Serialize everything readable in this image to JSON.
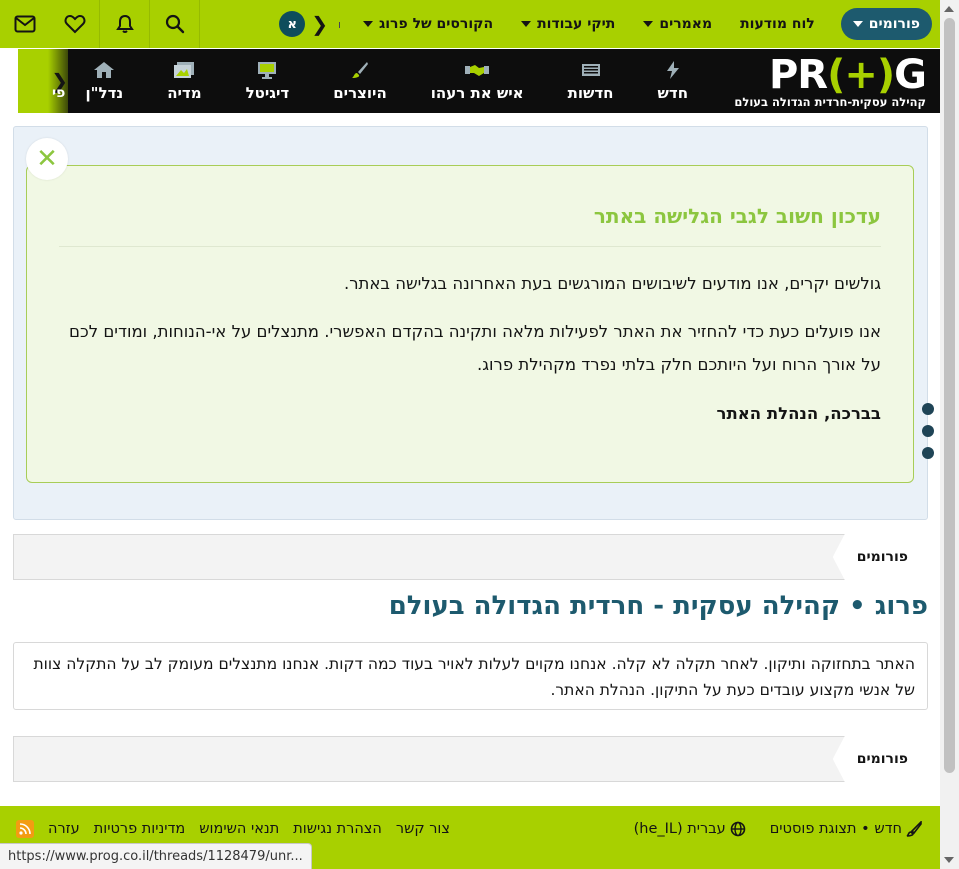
{
  "topnav": {
    "forums": "פורומים",
    "items": [
      "לוח מודעות",
      "מאמרים",
      "תיקי עבודות",
      "הקורסים של פרוג"
    ],
    "partial": "ו",
    "avatar_letter": "א"
  },
  "catbar": {
    "logo_word_a": "PR",
    "logo_word_b": "G",
    "logo_tagline": "קהילה עסקית-חרדית הגדולה בעולם",
    "items": [
      "חדש",
      "חדשות",
      "איש את רעהו",
      "היוצרים",
      "דיגיטל",
      "מדיה",
      "נדל\"ן"
    ],
    "peek": "פי"
  },
  "notice": {
    "title": "עדכון חשוב לגבי הגלישה באתר",
    "p1": "גולשים יקרים, אנו מודעים לשיבושים המורגשים בעת האחרונה בגלישה באתר.",
    "p2": "אנו פועלים כעת כדי להחזיר את האתר לפעילות מלאה ותקינה בהקדם האפשרי. מתנצלים על אי-הנוחות, ומודים לכם על אורך הרוח ועל היותכם חלק בלתי נפרד מקהילת פרוג.",
    "p3": "בברכה, הנהלת האתר"
  },
  "breadcrumb": {
    "label": "פורומים"
  },
  "page_title": "פרוג • קהילה עסקית - חרדית הגדולה בעולם",
  "info": "האתר בתחזוקה ותיקון. לאחר תקלה לא קלה. אנחנו מקוים לעלות לאויר בעוד כמה דקות. אנחנו מתנצלים מעומק לב על התקלה צוות של אנשי מקצוע עובדים כעת על התיקון. הנהלת האתר.",
  "footer": {
    "new_posts": "חדש • תצוגת פוסטים",
    "language": "עברית (he_IL)",
    "links": [
      "צור קשר",
      "הצהרת נגישות",
      "תנאי השימוש",
      "מדיניות פרטיות",
      "עזרה"
    ]
  },
  "status_url": "https://www.prog.co.il/threads/1128479/unr...",
  "colors": {
    "green": "#a8d000",
    "teal": "#1d5a6e",
    "black": "#0d0d0d"
  }
}
